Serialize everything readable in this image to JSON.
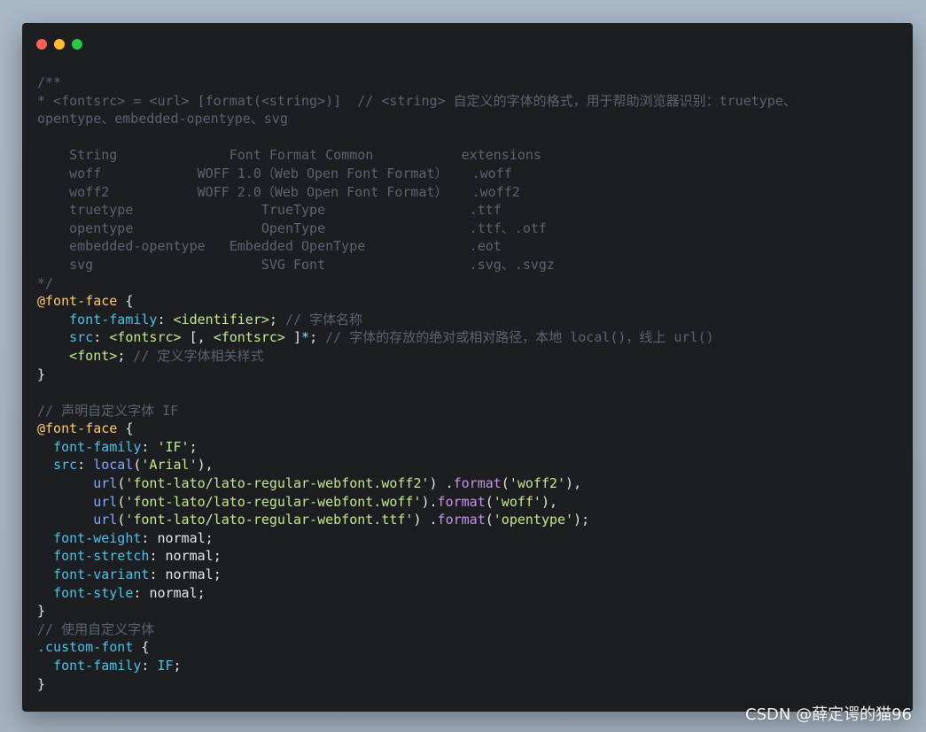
{
  "window": {
    "controls": [
      "close",
      "minimize",
      "maximize"
    ]
  },
  "code_lines": [
    [
      [
        "cm",
        "/**"
      ]
    ],
    [
      [
        "cm",
        "* <fontsrc> = <url> [format(<string>)]  // <string> 自定义的字体的格式，用于帮助浏览器识别：truetype、"
      ]
    ],
    [
      [
        "cm",
        "opentype、embedded-opentype、svg"
      ]
    ],
    [
      [
        "cm",
        ""
      ]
    ],
    [
      [
        "cm",
        "    String              Font Format Common           extensions"
      ]
    ],
    [
      [
        "cm",
        "    woff            WOFF 1.0（Web Open Font Format）   .woff"
      ]
    ],
    [
      [
        "cm",
        "    woff2           WOFF 2.0（Web Open Font Format）   .woff2"
      ]
    ],
    [
      [
        "cm",
        "    truetype                TrueType                  .ttf"
      ]
    ],
    [
      [
        "cm",
        "    opentype                OpenType                  .ttf、.otf"
      ]
    ],
    [
      [
        "cm",
        "    embedded-opentype   Embedded OpenType             .eot"
      ]
    ],
    [
      [
        "cm",
        "    svg                     SVG Font                  .svg、.svgz"
      ]
    ],
    [
      [
        "cm",
        "*/"
      ]
    ],
    [
      [
        "kw",
        "@font-face"
      ],
      [
        "tx",
        " {"
      ]
    ],
    [
      [
        "tx",
        "    "
      ],
      [
        "pr",
        "font-family"
      ],
      [
        "tx",
        ": "
      ],
      [
        "tg",
        "<identifier>"
      ],
      [
        "tx",
        "; "
      ],
      [
        "cm",
        "// 字体名称"
      ]
    ],
    [
      [
        "tx",
        "    "
      ],
      [
        "pr",
        "src"
      ],
      [
        "tx",
        ": "
      ],
      [
        "tg",
        "<fontsrc>"
      ],
      [
        "tx",
        " [, "
      ],
      [
        "tg",
        "<fontsrc>"
      ],
      [
        "tx",
        " ]"
      ],
      [
        "op",
        "*"
      ],
      [
        "tx",
        "; "
      ],
      [
        "cm",
        "// 字体的存放的绝对或相对路径，本地 local()，线上 url()"
      ]
    ],
    [
      [
        "tx",
        "    "
      ],
      [
        "tg",
        "<font>"
      ],
      [
        "tx",
        "; "
      ],
      [
        "cm",
        "// 定义字体相关样式"
      ]
    ],
    [
      [
        "tx",
        "}"
      ]
    ],
    [
      [
        "tx",
        ""
      ]
    ],
    [
      [
        "cm",
        "// 声明自定义字体 IF"
      ]
    ],
    [
      [
        "kw",
        "@font-face"
      ],
      [
        "tx",
        " {"
      ]
    ],
    [
      [
        "tx",
        "  "
      ],
      [
        "pr",
        "font-family"
      ],
      [
        "tx",
        ": "
      ],
      [
        "st",
        "'IF'"
      ],
      [
        "tx",
        ";"
      ]
    ],
    [
      [
        "tx",
        "  "
      ],
      [
        "pr",
        "src"
      ],
      [
        "tx",
        ": "
      ],
      [
        "fn",
        "local"
      ],
      [
        "tx",
        "("
      ],
      [
        "st",
        "'Arial'"
      ],
      [
        "tx",
        "),"
      ]
    ],
    [
      [
        "tx",
        "       "
      ],
      [
        "fn",
        "url"
      ],
      [
        "tx",
        "("
      ],
      [
        "st",
        "'font-lato/lato-regular-webfont.woff2'"
      ],
      [
        "tx",
        ") ."
      ],
      [
        "mt",
        "format"
      ],
      [
        "tx",
        "("
      ],
      [
        "st",
        "'woff2'"
      ],
      [
        "tx",
        "),"
      ]
    ],
    [
      [
        "tx",
        "       "
      ],
      [
        "fn",
        "url"
      ],
      [
        "tx",
        "("
      ],
      [
        "st",
        "'font-lato/lato-regular-webfont.woff'"
      ],
      [
        "tx",
        ")."
      ],
      [
        "mt",
        "format"
      ],
      [
        "tx",
        "("
      ],
      [
        "st",
        "'woff'"
      ],
      [
        "tx",
        "),"
      ]
    ],
    [
      [
        "tx",
        "       "
      ],
      [
        "fn",
        "url"
      ],
      [
        "tx",
        "("
      ],
      [
        "st",
        "'font-lato/lato-regular-webfont.ttf'"
      ],
      [
        "tx",
        ") ."
      ],
      [
        "mt",
        "format"
      ],
      [
        "tx",
        "("
      ],
      [
        "st",
        "'opentype'"
      ],
      [
        "tx",
        ");"
      ]
    ],
    [
      [
        "tx",
        "  "
      ],
      [
        "pr",
        "font-weight"
      ],
      [
        "tx",
        ": "
      ],
      [
        "tx",
        "normal"
      ],
      [
        "tx",
        ";"
      ]
    ],
    [
      [
        "tx",
        "  "
      ],
      [
        "pr",
        "font-stretch"
      ],
      [
        "tx",
        ": "
      ],
      [
        "tx",
        "normal"
      ],
      [
        "tx",
        ";"
      ]
    ],
    [
      [
        "tx",
        "  "
      ],
      [
        "pr",
        "font-variant"
      ],
      [
        "tx",
        ": "
      ],
      [
        "tx",
        "normal"
      ],
      [
        "tx",
        ";"
      ]
    ],
    [
      [
        "tx",
        "  "
      ],
      [
        "pr",
        "font-style"
      ],
      [
        "tx",
        ": "
      ],
      [
        "tx",
        "normal"
      ],
      [
        "tx",
        ";"
      ]
    ],
    [
      [
        "tx",
        "}"
      ]
    ],
    [
      [
        "cm",
        "// 使用自定义字体"
      ]
    ],
    [
      [
        "sel",
        ".custom-font"
      ],
      [
        "tx",
        " {"
      ]
    ],
    [
      [
        "tx",
        "  "
      ],
      [
        "pr",
        "font-family"
      ],
      [
        "tx",
        ": "
      ],
      [
        "pr",
        "IF"
      ],
      [
        "tx",
        ";"
      ]
    ],
    [
      [
        "tx",
        "}"
      ]
    ]
  ],
  "watermark": "CSDN @薛定谔的猫96",
  "colors": {
    "background": "#a9b8c6",
    "window": "#1c1e21",
    "comment": "#5c6370",
    "keyword": "#ffcb6b",
    "property": "#4fc1e9",
    "string": "#c3e88d",
    "function": "#82aaff",
    "method": "#c792ea"
  }
}
